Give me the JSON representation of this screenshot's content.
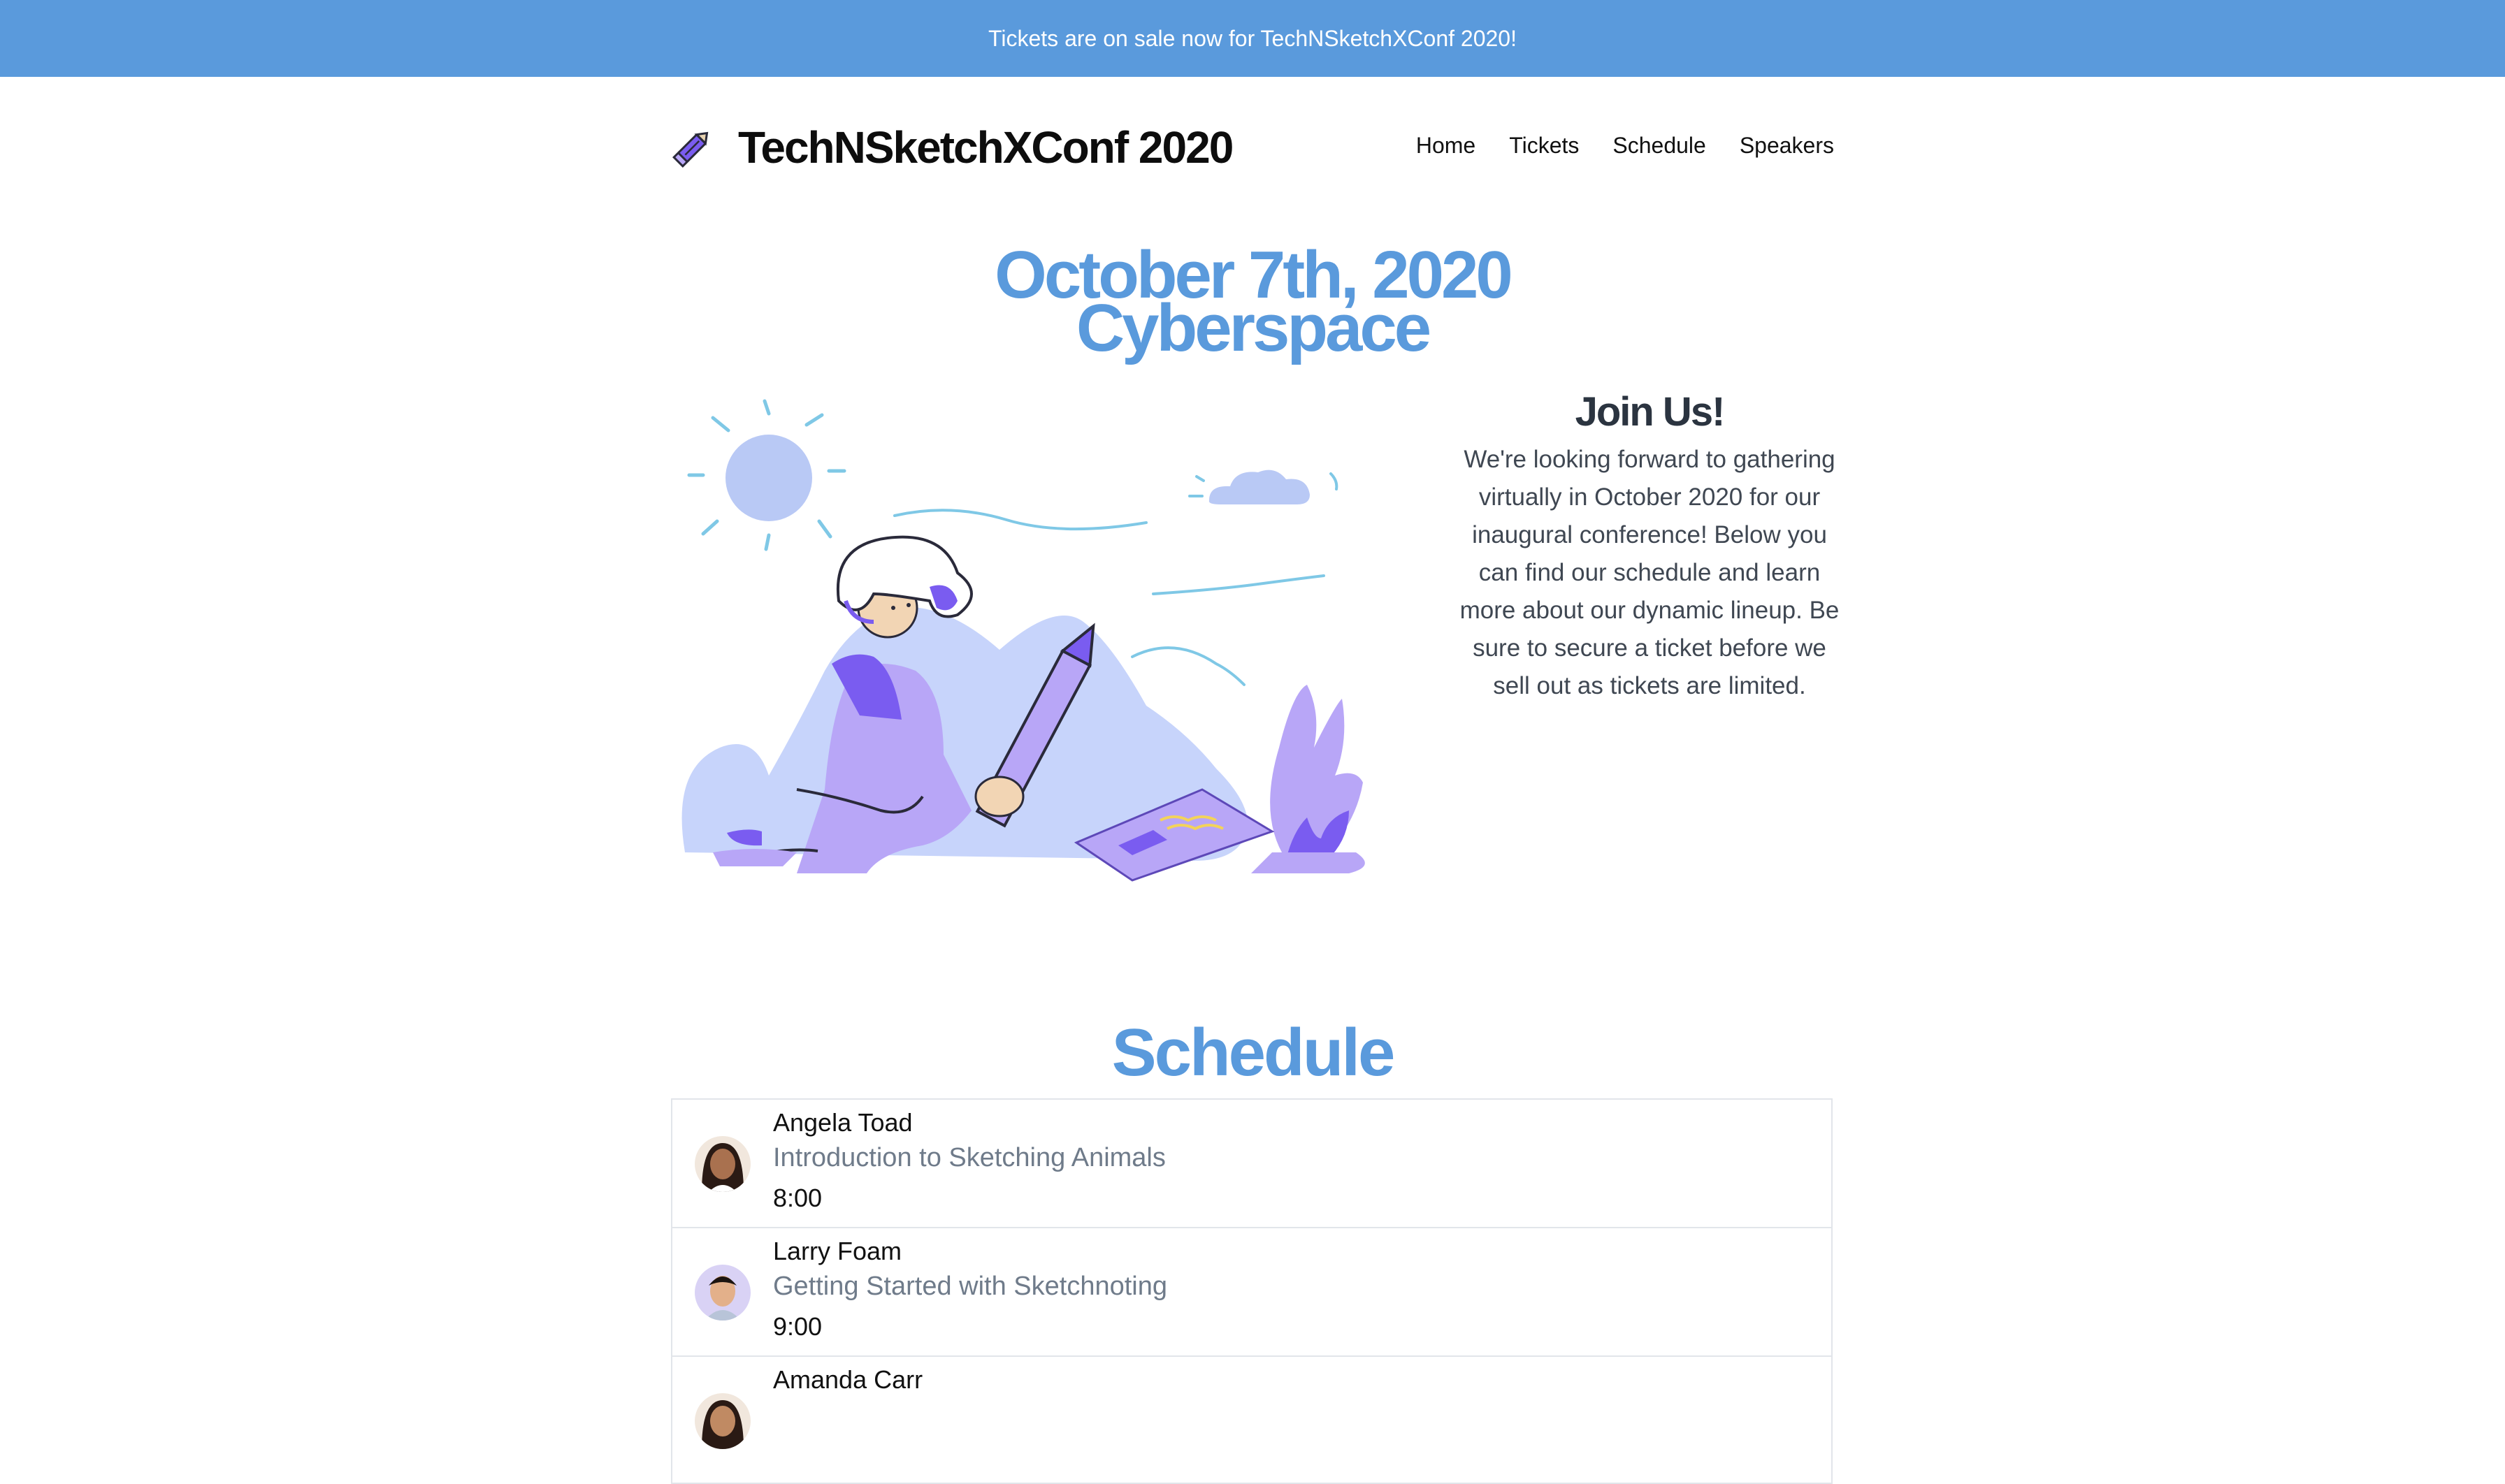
{
  "banner": {
    "text": "Tickets are on sale now for TechNSketchXConf 2020!",
    "color": "#5a9adc"
  },
  "header": {
    "brand": "TechNSketchXConf 2020",
    "logo_icon": "pencil-icon",
    "nav": [
      "Home",
      "Tickets",
      "Schedule",
      "Speakers"
    ]
  },
  "hero": {
    "line1": "October 7th, 2020",
    "line2": "Cyberspace",
    "accent_color": "#5a9adc"
  },
  "join": {
    "title": "Join Us!",
    "body": "We're looking forward to gathering virtually in October 2020 for our inaugural conference! Below you can find our schedule and learn more about our dynamic lineup. Be sure to secure a ticket before we sell out as tickets are limited."
  },
  "schedule": {
    "title": "Schedule",
    "items": [
      {
        "speaker": "Angela Toad",
        "talk": "Introduction to Sketching Animals",
        "time": "8:00",
        "avatar_icon": "avatar-woman-icon"
      },
      {
        "speaker": "Larry Foam",
        "talk": "Getting Started with Sketchnoting",
        "time": "9:00",
        "avatar_icon": "avatar-man-icon"
      },
      {
        "speaker": "Amanda Carr",
        "talk": "",
        "time": "",
        "avatar_icon": "avatar-woman-icon"
      }
    ]
  }
}
